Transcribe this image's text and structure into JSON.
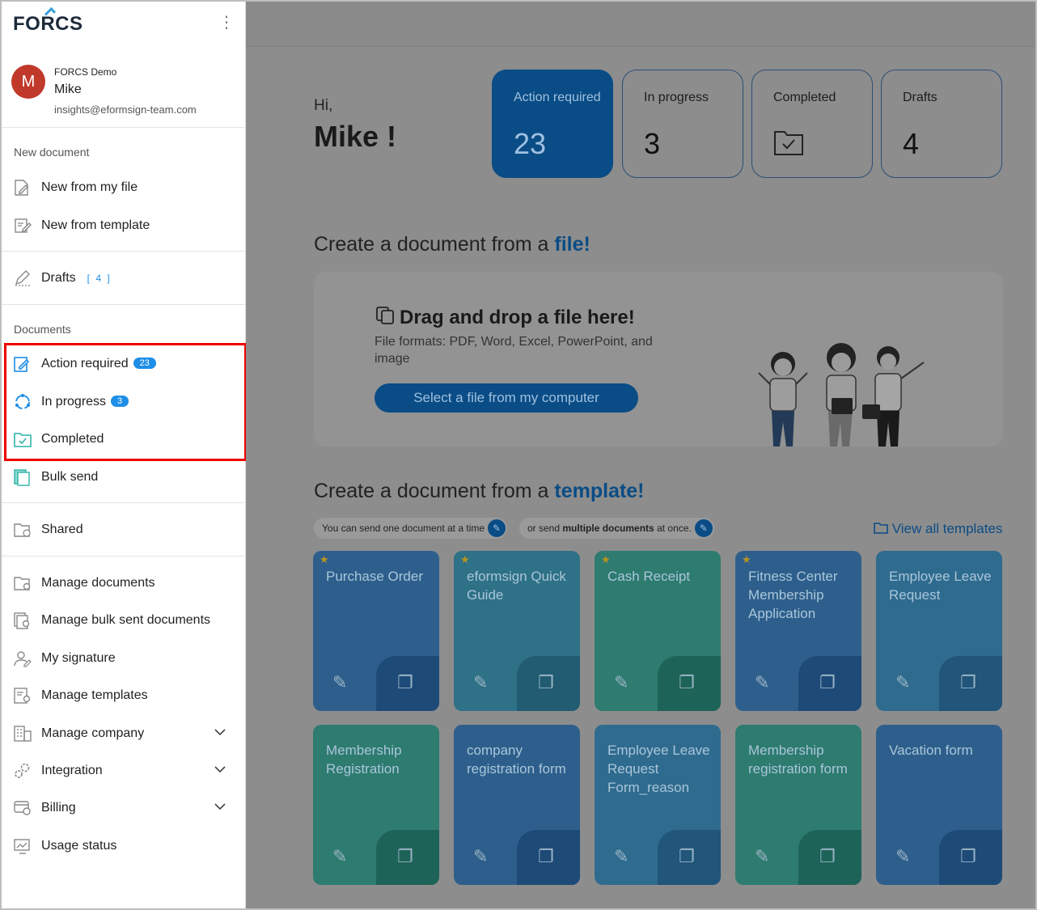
{
  "sidebar": {
    "logo": "FORCS",
    "kebab": "⋮",
    "profile": {
      "initial": "M",
      "company": "FORCS Demo",
      "name": "Mike",
      "email": "insights@eformsign-team.com"
    },
    "new_document_title": "New document",
    "new_from_file": "New from my file",
    "new_from_template": "New from template",
    "drafts": "Drafts",
    "drafts_count": "[ 4 ]",
    "documents_title": "Documents",
    "action_required": "Action required",
    "action_required_badge": "23",
    "in_progress": "In progress",
    "in_progress_badge": "3",
    "completed": "Completed",
    "bulk_send": "Bulk send",
    "shared": "Shared",
    "manage_documents": "Manage documents",
    "manage_bulk_sent": "Manage bulk sent documents",
    "my_signature": "My signature",
    "manage_templates": "Manage templates",
    "manage_company": "Manage company",
    "integration": "Integration",
    "billing": "Billing",
    "usage_status": "Usage status"
  },
  "greeting": {
    "hi": "Hi,",
    "name": "Mike !"
  },
  "stats": [
    {
      "label": "Action required",
      "value": "23"
    },
    {
      "label": "In progress",
      "value": "3"
    },
    {
      "label": "Completed",
      "value": ""
    },
    {
      "label": "Drafts",
      "value": "4"
    }
  ],
  "file_section": {
    "heading_prefix": "Create a document from a",
    "heading_accent": "file!",
    "drop_title": "Drag and drop a file here!",
    "drop_sub": "File formats: PDF, Word, Excel, PowerPoint, and image",
    "select_button": "Select a file from my computer"
  },
  "template_section": {
    "heading_prefix": "Create a document from a",
    "heading_accent": "template!",
    "hint_one_prefix": "You can send one document at a time",
    "hint_multi_prefix": "or send",
    "hint_multi_bold": "multiple documents",
    "hint_multi_suffix": "at once.",
    "view_all": "View all templates"
  },
  "templates": [
    {
      "title": "Purchase Order",
      "starred": true
    },
    {
      "title": "eformsign Quick Guide",
      "starred": true
    },
    {
      "title": "Cash Receipt",
      "starred": true
    },
    {
      "title": "Fitness Center Membership Application",
      "starred": true
    },
    {
      "title": "Employee Leave Request",
      "starred": false
    },
    {
      "title": "Membership Registration",
      "starred": false
    },
    {
      "title": "company registration form",
      "starred": false
    },
    {
      "title": "Employee Leave Request Form_reason",
      "starred": false
    },
    {
      "title": "Membership registration form",
      "starred": false
    },
    {
      "title": "Vacation form",
      "starred": false
    }
  ],
  "colors": {
    "accent": "#0a4c85",
    "badge": "#1e8ee6",
    "highlight": "#ee0000",
    "avatar": "#c0392b"
  }
}
